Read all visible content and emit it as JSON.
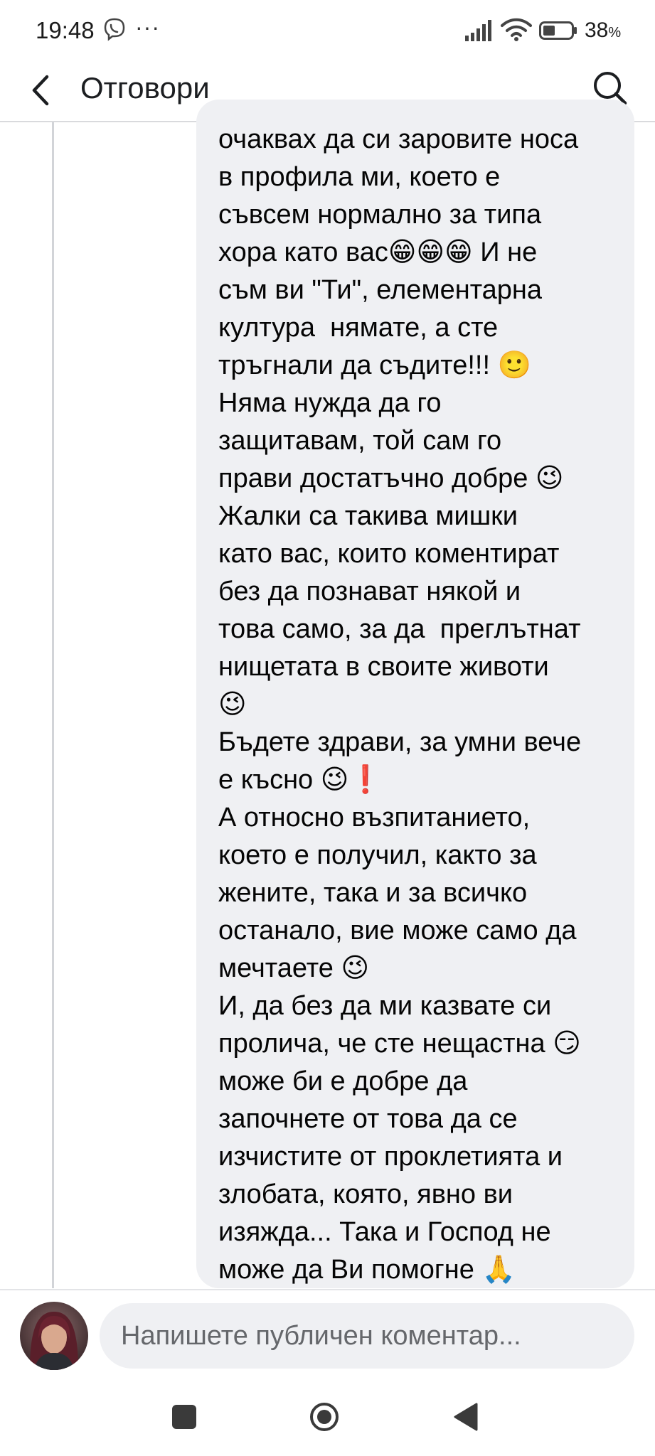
{
  "status_bar": {
    "time": "19:48",
    "more": "···",
    "battery": "38",
    "battery_unit": "%",
    "icons": [
      "viber-icon",
      "signal-icon",
      "wifi-icon",
      "battery-icon"
    ]
  },
  "header": {
    "title": "Отговори",
    "icons": [
      "back-icon",
      "search-icon"
    ]
  },
  "comment": {
    "text": "очаквах да си заровите носа\nв профила ми, което е\nсъвсем нормално за типа\nхора като вас😁😁😁 И не\nсъм ви \"Ти\", елементарна\nкултура  нямате, а сте\nтръгнали да съдите!!! 🙂\nНяма нужда да го\nзащитавам, той сам го\nправи достатъчно добре 😉\nЖалки са такива мишки\nкато вас, които коментират\nбез да познават някой и\nтова само, за да  преглътнат\nнищетата в своите животи\n😉\nБъдете здрави, за умни вече\nе късно 😉❗\nА относно възпитанието,\nкоето е получил, както за\nжените, така и за всичко\nостанало, вие може само да\nмечтаете 😉\nИ, да без да ми казвате си\nпролича, че сте нещастна 😏\nможе би е добре да\nзапочнете от това да се\nизчистите от проклетията и\nзлобата, която, явно ви\nизяжда... Така и Господ не\nможе да Ви помогне 🙏"
  },
  "composer": {
    "placeholder": "Напишете публичен коментар..."
  },
  "colors": {
    "bubble": "#eff0f3",
    "text": "#050505",
    "placeholder": "#65676b",
    "divider": "#d9dadd"
  }
}
